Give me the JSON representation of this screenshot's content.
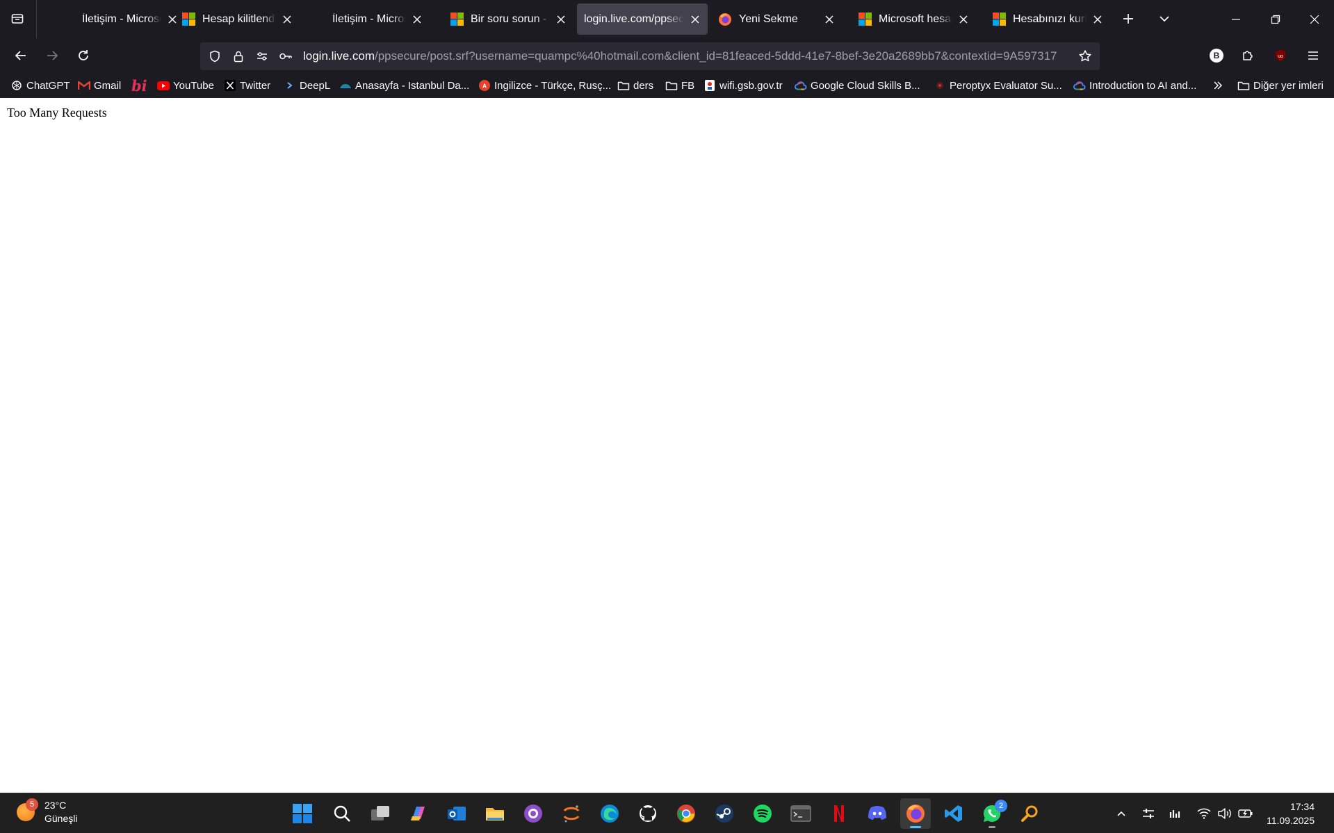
{
  "browser": {
    "tabs": [
      {
        "title": "İletişim - Microsoft",
        "favicon": "none",
        "active": false
      },
      {
        "title": "Hesap kilitlendi - Microsoft",
        "favicon": "microsoft-logo",
        "active": false
      },
      {
        "title": "İletişim - Microsoft",
        "favicon": "none",
        "active": false
      },
      {
        "title": "Bir soru sorun - Microsoft",
        "favicon": "microsoft-logo",
        "active": false
      },
      {
        "title": "login.live.com/ppsecure",
        "favicon": "none",
        "active": true
      },
      {
        "title": "Yeni Sekme",
        "favicon": "firefox-logo",
        "active": false
      },
      {
        "title": "Microsoft hesap kurtarma",
        "favicon": "microsoft-logo",
        "active": false
      },
      {
        "title": "Hesabınızı kurtarın",
        "favicon": "microsoft-logo",
        "active": false
      }
    ],
    "url": {
      "host": "login.live.com",
      "path": "/ppsecure/post.srf?username=quampc%40hotmail.com&client_id=81feaced-5ddd-41e7-8bef-3e20a2689bb7&contextid=9A597317"
    },
    "extension_badge": "B",
    "bookmarks": [
      {
        "label": "ChatGPT",
        "icon": "openai-icon"
      },
      {
        "label": "Gmail",
        "icon": "gmail-icon"
      },
      {
        "label": "",
        "icon": "bi-icon"
      },
      {
        "label": "YouTube",
        "icon": "youtube-icon"
      },
      {
        "label": "Twitter",
        "icon": "x-icon"
      },
      {
        "label": "DeepL",
        "icon": "deepl-icon"
      },
      {
        "label": "Anasayfa - Istanbul Da...",
        "icon": "istanbul-icon"
      },
      {
        "label": "Ingilizce - Türkçe, Rusç...",
        "icon": "translate-icon"
      },
      {
        "label": "ders",
        "icon": "folder-icon"
      },
      {
        "label": "FB",
        "icon": "folder-icon"
      },
      {
        "label": "wifi.gsb.gov.tr",
        "icon": "gsb-icon"
      },
      {
        "label": "Google Cloud Skills B...",
        "icon": "google-cloud-icon"
      },
      {
        "label": "Peroptyx Evaluator Su...",
        "icon": "peroptyx-icon"
      },
      {
        "label": "Introduction to AI and...",
        "icon": "google-cloud-icon"
      }
    ],
    "other_bookmarks": "Diğer yer imleri"
  },
  "page": {
    "message": "Too Many Requests"
  },
  "taskbar": {
    "weather": {
      "temp": "23°C",
      "condition": "Güneşli",
      "badge": "5"
    },
    "apps": [
      "windows-start-icon",
      "search-icon",
      "task-view-icon",
      "copilot-icon",
      "outlook-icon",
      "file-explorer-icon",
      "github-desktop-icon",
      "jupyter-icon",
      "edge-icon",
      "github-icon",
      "chrome-icon",
      "steam-icon",
      "spotify-icon",
      "terminal-icon",
      "netflix-icon",
      "discord-icon",
      "firefox-icon",
      "vscode-icon",
      "whatsapp-icon",
      "search-magnifier-icon"
    ],
    "whatsapp_badge": "2",
    "time": "17:34",
    "date": "11.09.2025"
  }
}
